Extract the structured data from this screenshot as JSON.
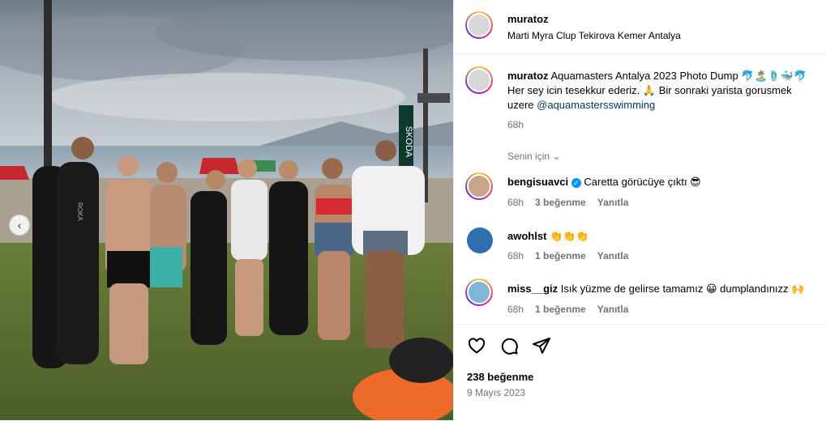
{
  "post": {
    "username": "muratoz",
    "location": "Marti Myra Clup Tekirova Kemer Antalya"
  },
  "caption": {
    "username": "muratoz",
    "line1": "Aquamasters Antalya 2023 Photo Dump 🐬🏝️🩴🐳🐬",
    "line2": "Her sey icin tesekkur ederiz. 🙏 Bir sonraki yarista gorusmek",
    "line3_prefix": "uzere ",
    "mention": "@aquamastersswimming",
    "time": "68h"
  },
  "translate": {
    "label": "Senin için"
  },
  "comments": [
    {
      "username": "bengisuavci",
      "verified": true,
      "text": "Caretta görücüye çıktı 😎",
      "time": "68h",
      "likes": "3 beğenme",
      "reply": "Yanıtla"
    },
    {
      "username": "awohlst",
      "verified": false,
      "text": "👏👏👏",
      "time": "68h",
      "likes": "1 beğenme",
      "reply": "Yanıtla"
    },
    {
      "username": "miss__giz",
      "verified": false,
      "text": "Isık yüzme de gelirse tamamız 😀 dumplandınızz 🙌",
      "time": "68h",
      "likes": "1 beğenme",
      "reply": "Yanıtla"
    }
  ],
  "footer": {
    "likes": "238 beğenme",
    "date": "9 Mayıs 2023"
  },
  "photo": {
    "banner_text": "SKODA",
    "wetsuit_text": "ROKA"
  },
  "colors": {
    "link": "#00376b",
    "verified": "#0095f6",
    "meta": "#737373"
  }
}
